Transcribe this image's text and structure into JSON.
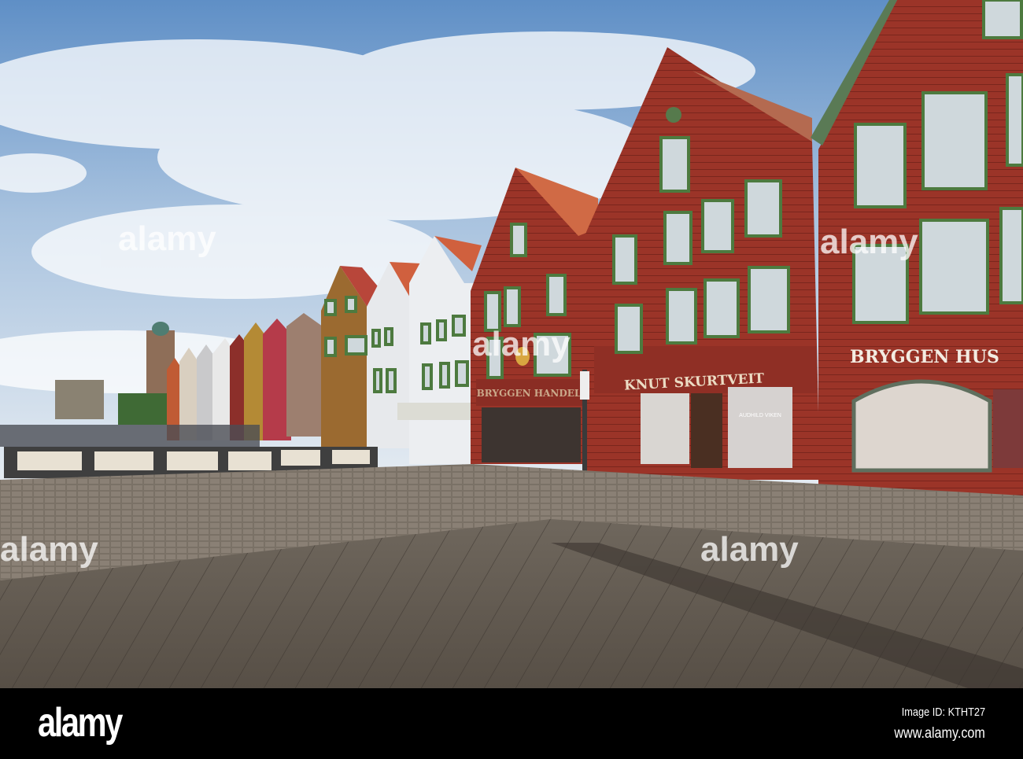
{
  "signs": {
    "knut": "KNUT SKURTVEIT",
    "handel": "BRYGGEN  HANDEL",
    "hus": "BRYGGEN HUS",
    "window_brand": "AUDHILD VIKEN"
  },
  "watermark": "alamy",
  "footer": {
    "logo": "alamy",
    "image_id": "Image ID: KTHT27",
    "url": "www.alamy.com"
  }
}
